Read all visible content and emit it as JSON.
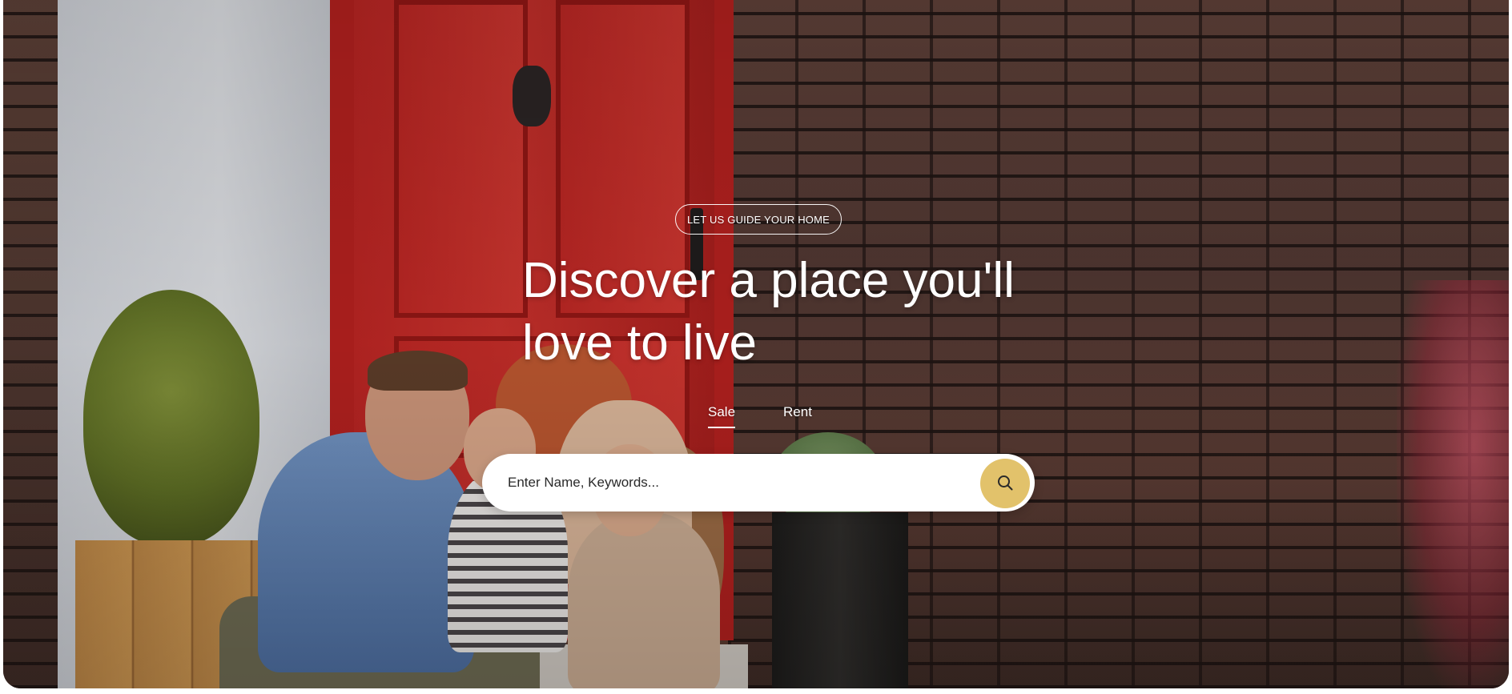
{
  "hero": {
    "tagline": "LET US GUIDE YOUR HOME",
    "headline": "Discover a place you'll love to live"
  },
  "tabs": [
    {
      "label": "Sale",
      "active": true
    },
    {
      "label": "Rent",
      "active": false
    }
  ],
  "search": {
    "placeholder": "Enter Name, Keywords...",
    "value": "",
    "button_icon": "search-icon"
  },
  "colors": {
    "accent": "#e2c26b",
    "text_on_image": "#ffffff"
  }
}
